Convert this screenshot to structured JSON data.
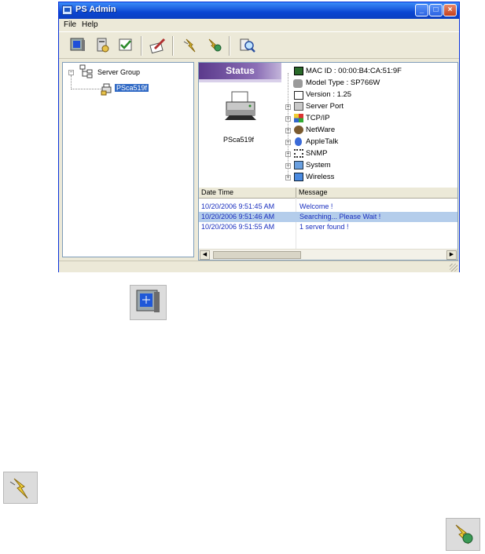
{
  "window": {
    "title": "PS Admin",
    "controls": [
      "minimize",
      "maximize",
      "close"
    ]
  },
  "menu": [
    "File",
    "Help"
  ],
  "toolbar": {
    "icons": [
      "monitor-icon",
      "server-settings-icon",
      "check-icon",
      "edit-icon",
      "lightning-icon",
      "lightning-stop-icon",
      "search-icon"
    ]
  },
  "tree": {
    "root": "Server Group",
    "child": "PSca519f"
  },
  "status": {
    "banner": "Status",
    "device_name": "PSca519f"
  },
  "properties": [
    {
      "label": "MAC ID : 00:00:B4:CA:51:9F",
      "expandable": false,
      "icon": "chip-icon"
    },
    {
      "label": "Model Type : SP766W",
      "expandable": false,
      "icon": "device-icon"
    },
    {
      "label": "Version : 1.25",
      "expandable": false,
      "icon": "version-icon"
    },
    {
      "label": "Server Port",
      "expandable": true,
      "icon": "port-icon"
    },
    {
      "label": "TCP/IP",
      "expandable": true,
      "icon": "tcpip-icon"
    },
    {
      "label": "NetWare",
      "expandable": true,
      "icon": "netware-icon"
    },
    {
      "label": "AppleTalk",
      "expandable": true,
      "icon": "apple-icon"
    },
    {
      "label": "SNMP",
      "expandable": true,
      "icon": "snmp-icon"
    },
    {
      "label": "System",
      "expandable": true,
      "icon": "system-icon"
    },
    {
      "label": "Wireless",
      "expandable": true,
      "icon": "wireless-icon"
    }
  ],
  "log": {
    "columns": [
      "Date Time",
      "Message"
    ],
    "rows": [
      {
        "datetime": "10/20/2006 9:51:45 AM",
        "message": "Welcome !",
        "highlight": false
      },
      {
        "datetime": "10/20/2006 9:51:46 AM",
        "message": "Searching... Please Wait !",
        "highlight": true
      },
      {
        "datetime": "10/20/2006 9:51:55 AM",
        "message": "1 server found !",
        "highlight": false
      }
    ]
  },
  "colors": {
    "titlebar": "#0a46d2",
    "banner": "#5b3a8c",
    "log_text": "#1a2fbf",
    "selection": "#316ac5"
  },
  "floating_icons": [
    "monitor-icon",
    "lightning-icon",
    "lightning-stop-icon"
  ]
}
